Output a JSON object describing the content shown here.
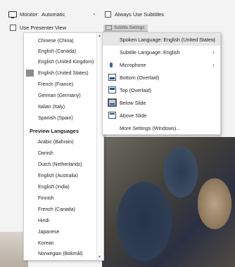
{
  "toolbar": {
    "monitor_label": "Monitor:",
    "monitor_value": "Automatic",
    "always_subtitles": "Always Use Subtitles",
    "presenter_view": "Use Presenter View",
    "subtitle_settings": "Subtitle Settings"
  },
  "languages": {
    "items": [
      "Chinese (China)",
      "English (Canada)",
      "English (United Kingdom)",
      "English (United States)",
      "French (France)",
      "German (Germany)",
      "Italian (Italy)",
      "Spanish (Spain)"
    ],
    "preview_header": "Preview Languages",
    "preview_items": [
      "Arabic (Bahrain)",
      "Danish",
      "Dutch (Netherlands)",
      "English (Australia)",
      "English (India)",
      "Finnish",
      "French (Canada)",
      "Hindi",
      "Japanese",
      "Korean",
      "Norwegian (Bokmål)"
    ]
  },
  "submenu": {
    "spoken": "Spoken Language: English (United States)",
    "subtitle_lang": "Subtitle Language: English",
    "microphone": "Microphone",
    "bottom": "Bottom (Overlaid)",
    "top": "Top (Overlaid)",
    "below": "Below Slide",
    "above": "Above Slide",
    "more": "More Settings (Windows)..."
  }
}
